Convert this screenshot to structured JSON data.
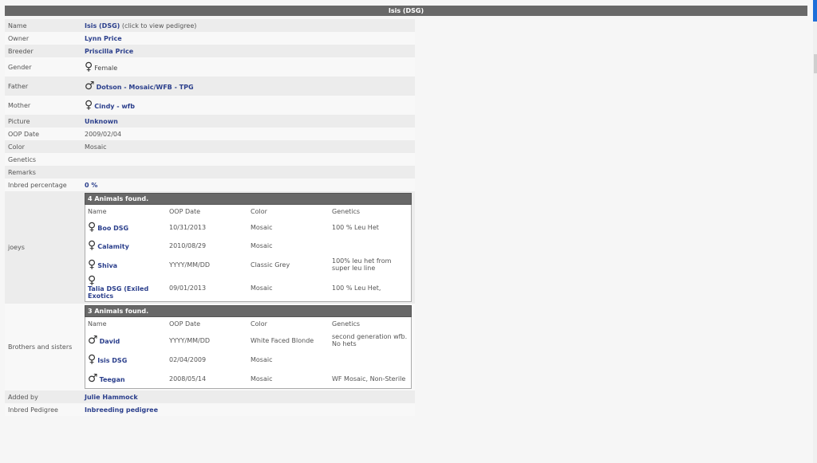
{
  "header": {
    "title": "Isis (DSG)"
  },
  "details": {
    "name_label": "Name",
    "name_value": "Isis (DSG)",
    "name_hint": "(click to view pedigree)",
    "owner_label": "Owner",
    "owner_value": "Lynn Price",
    "breeder_label": "Breeder",
    "breeder_value": "Priscilla Price",
    "gender_label": "Gender",
    "gender_symbol": "♀",
    "gender_value": "Female",
    "father_label": "Father",
    "father_symbol": "♂",
    "father_value": "Dotson - Mosaic/WFB - TPG",
    "mother_label": "Mother",
    "mother_symbol": "♀",
    "mother_value": "Cindy - wfb",
    "picture_label": "Picture",
    "picture_value": "Unknown",
    "oop_label": "OOP Date",
    "oop_value": "2009/02/04",
    "color_label": "Color",
    "color_value": "Mosaic",
    "genetics_label": "Genetics",
    "genetics_value": "",
    "remarks_label": "Remarks",
    "remarks_value": "",
    "inbred_label": "Inbred percentage",
    "inbred_value": "0 %",
    "joeys_label": "joeys",
    "siblings_label": "Brothers and sisters",
    "added_label": "Added by",
    "added_value": "Julie Hammock",
    "pedigree_label": "Inbred Pedigree",
    "pedigree_value": "Inbreeding pedigree"
  },
  "table_headers": {
    "name": "Name",
    "oop": "OOP Date",
    "color": "Color",
    "genetics": "Genetics"
  },
  "joeys": {
    "count_text": "4 Animals found.",
    "rows": [
      {
        "symbol": "♀",
        "name": "Boo DSG",
        "oop": "10/31/2013",
        "color": "Mosaic",
        "genetics": "100 % Leu Het"
      },
      {
        "symbol": "♀",
        "name": "Calamity",
        "oop": "2010/08/29",
        "color": "Mosaic",
        "genetics": ""
      },
      {
        "symbol": "♀",
        "name": "Shiva",
        "oop": "YYYY/MM/DD",
        "color": "Classic Grey",
        "genetics": "100% leu het from super leu line"
      },
      {
        "symbol": "♀",
        "name": "Talia DSG (Exiled Exotics",
        "oop": "09/01/2013",
        "color": "Mosaic",
        "genetics": "100 % Leu Het,"
      }
    ]
  },
  "siblings": {
    "count_text": "3 Animals found.",
    "rows": [
      {
        "symbol": "♂",
        "name": "David",
        "oop": "YYYY/MM/DD",
        "color": "White Faced Blonde",
        "genetics": "second generation wfb. No hets"
      },
      {
        "symbol": "♀",
        "name": "Isis DSG",
        "oop": "02/04/2009",
        "color": "Mosaic",
        "genetics": ""
      },
      {
        "symbol": "♂",
        "name": "Teegan",
        "oop": "2008/05/14",
        "color": "Mosaic",
        "genetics": "WF Mosaic, Non-Sterile"
      }
    ]
  }
}
